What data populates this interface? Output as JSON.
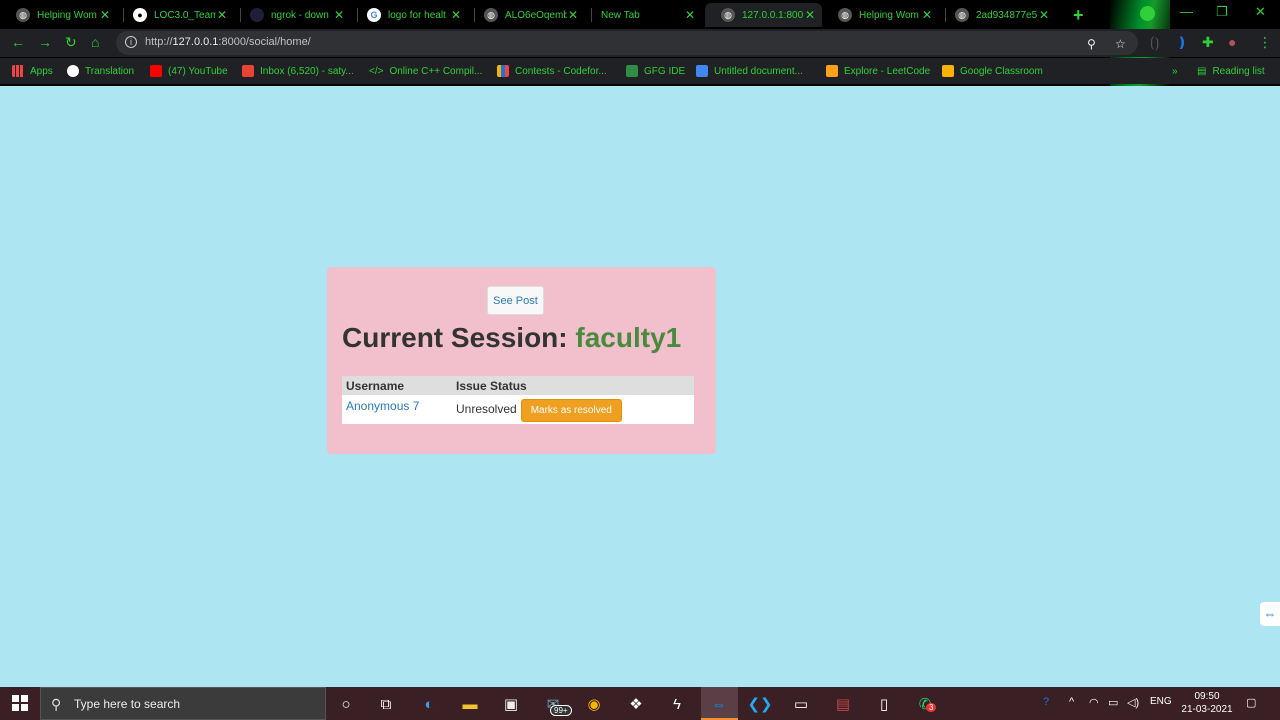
{
  "browser": {
    "tabs": [
      {
        "title": "Helping Wom",
        "icon": "globe-icon"
      },
      {
        "title": "LOC3.0_Team-",
        "icon": "github-icon"
      },
      {
        "title": "ngrok - down",
        "icon": "ngrok-icon"
      },
      {
        "title": "logo for healt",
        "icon": "google-icon"
      },
      {
        "title": "ALO6eOqemb",
        "icon": "globe-icon"
      },
      {
        "title": "New Tab",
        "icon": "none"
      },
      {
        "title": "127.0.0.1:800",
        "icon": "globe-icon",
        "active": true
      },
      {
        "title": "Helping Wom",
        "icon": "globe-icon"
      },
      {
        "title": "2ad934877e5",
        "icon": "globe-icon"
      }
    ],
    "new_tab_symbol": "+",
    "window_controls": {
      "minimize": "—",
      "maximize": "❐",
      "close": "✕"
    },
    "url_prefix": "http://",
    "url_host": "127.0.0.1",
    "url_rest": ":8000/social/home/",
    "bookmarks": [
      {
        "label": "Apps",
        "color": "#e44"
      },
      {
        "label": "Translation",
        "color": "#fff"
      },
      {
        "label": "(47) YouTube",
        "color": "#f00"
      },
      {
        "label": "Inbox (6,520) - saty...",
        "color": "#ea4335"
      },
      {
        "label": "Online C++ Compil...",
        "color": "#2ed13a"
      },
      {
        "label": "Contests - Codefor...",
        "color": "#f4b400"
      },
      {
        "label": "GFG IDE",
        "color": "#2f8d46"
      },
      {
        "label": "Untitled document...",
        "color": "#4285f4"
      },
      {
        "label": "Explore - LeetCode",
        "color": "#ffa116"
      },
      {
        "label": "Google Classroom",
        "color": "#f4b400"
      }
    ],
    "overflow": "»",
    "reading_list": "Reading list"
  },
  "page": {
    "see_post_label": "See Post",
    "session_prefix": "Current Session:",
    "session_user": "faculty1",
    "table": {
      "headers": [
        "Username",
        "Issue Status"
      ],
      "rows": [
        {
          "username": "Anonymous 7",
          "status": "Unresolved",
          "action": "Marks as resolved"
        }
      ]
    }
  },
  "taskbar": {
    "search_placeholder": "Type here to search",
    "store_badge": "99+",
    "whatsapp_badge": "3",
    "language": "ENG",
    "time": "09:50",
    "date": "21-03-2021"
  },
  "colors": {
    "page_background": "#aee5f2",
    "card_background": "#f2c0cc",
    "session_user": "#4a8a3e",
    "link": "#2a7ab8",
    "resolve_button": "#f0a020",
    "chrome_text": "#2ed13a"
  }
}
